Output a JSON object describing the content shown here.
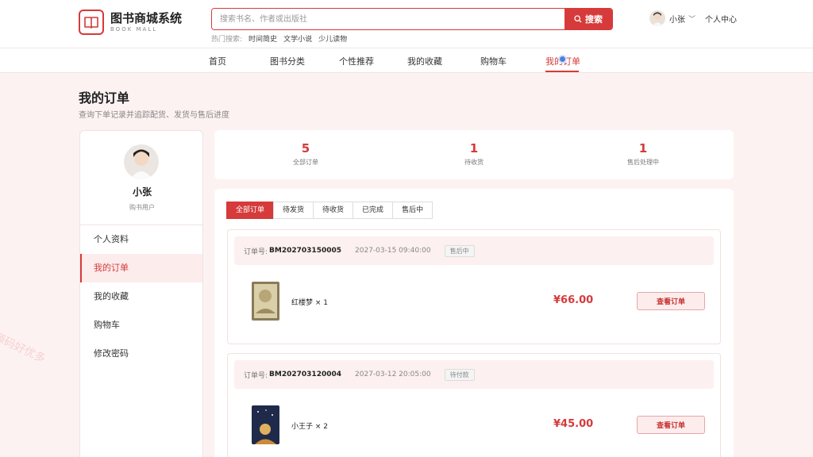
{
  "logo": {
    "title": "图书商城系统",
    "subtitle": "BOOK MALL"
  },
  "search": {
    "placeholder": "搜索书名、作者或出版社",
    "button": "搜索",
    "hot_label": "热门搜索:",
    "hot_keywords": [
      "时间简史",
      "文学小说",
      "少儿读物"
    ]
  },
  "user": {
    "name": "小张",
    "center": "个人中心"
  },
  "nav": [
    "首页",
    "图书分类",
    "个性推荐",
    "我的收藏",
    "购物车",
    "我的订单"
  ],
  "page": {
    "title": "我的订单",
    "desc": "查询下单记录并追踪配货、发货与售后进度"
  },
  "sidebar": {
    "name": "小张",
    "role": "购书用户",
    "items": [
      "个人资料",
      "我的订单",
      "我的收藏",
      "购物车",
      "修改密码"
    ]
  },
  "stats": [
    {
      "num": "5",
      "label": "全部订单"
    },
    {
      "num": "1",
      "label": "待收货"
    },
    {
      "num": "1",
      "label": "售后处理中"
    }
  ],
  "tabs": [
    "全部订单",
    "待发货",
    "待收货",
    "已完成",
    "售后中"
  ],
  "orders": [
    {
      "no_label": "订单号:",
      "no": "BM202703150005",
      "time": "2027-03-15 09:40:00",
      "status": "售后中",
      "book": "红楼梦 × 1",
      "price": "¥66.00",
      "action": "查看订单"
    },
    {
      "no_label": "订单号:",
      "no": "BM202703120004",
      "time": "2027-03-12 20:05:00",
      "status": "待付款",
      "book": "小王子 × 2",
      "price": "¥45.00",
      "action": "查看订单"
    }
  ],
  "watermark": "源码好优多",
  "colors": {
    "accent": "#d63a3a",
    "background": "#fdf2f2"
  }
}
